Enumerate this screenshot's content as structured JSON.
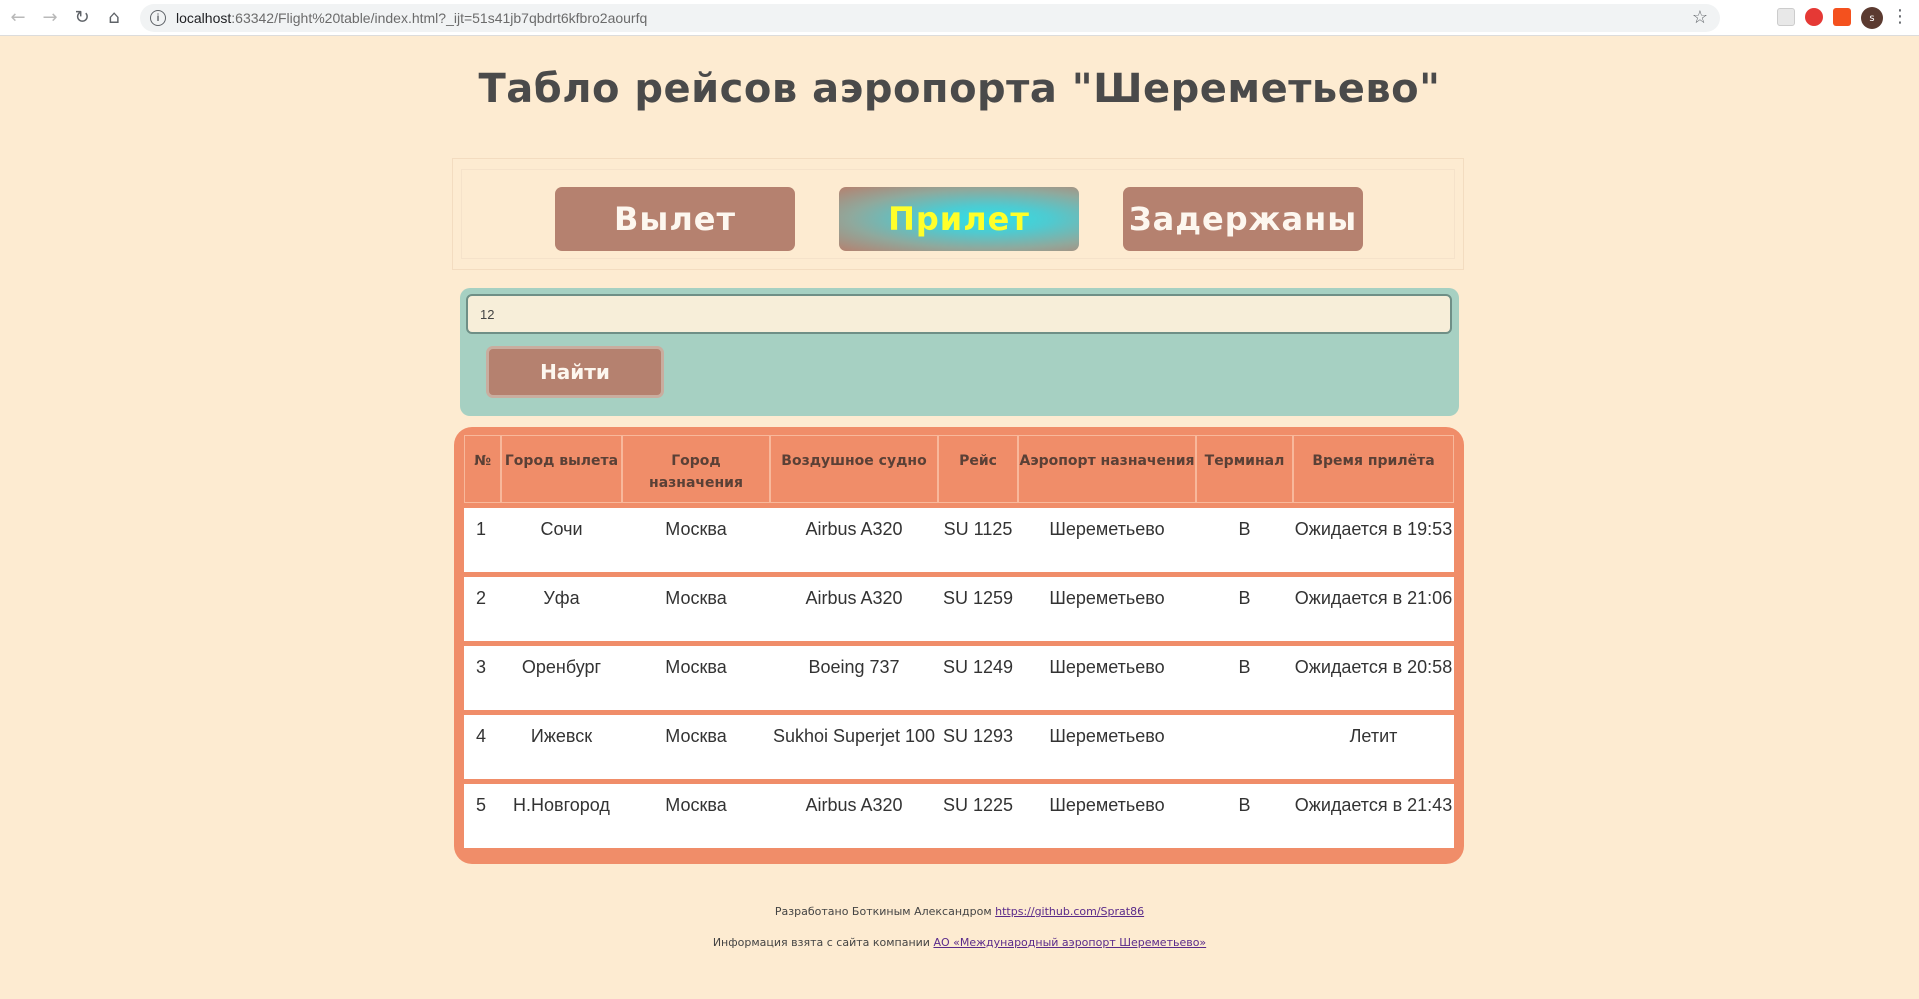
{
  "browser": {
    "url_host": "localhost",
    "url_path": ":63342/Flight%20table/index.html?_ijt=51s41jb7qbdrt6kfbro2aourfq",
    "avatar_letter": "s"
  },
  "page": {
    "title": "Табло рейсов аэропорта \"Шереметьево\""
  },
  "tabs": [
    {
      "label": "Вылет",
      "active": false
    },
    {
      "label": "Прилет",
      "active": true
    },
    {
      "label": "Задержаны",
      "active": false
    }
  ],
  "search": {
    "value": "12",
    "button_label": "Найти"
  },
  "table": {
    "headers": [
      "№",
      "Город вылета",
      "Город назначения",
      "Воздушное судно",
      "Рейс",
      "Аэропорт назначения",
      "Терминал",
      "Время прилёта"
    ],
    "rows": [
      [
        "1",
        "Сочи",
        "Москва",
        "Airbus A320",
        "SU 1125",
        "Шереметьево",
        "B",
        "Ожидается в 19:53"
      ],
      [
        "2",
        "Уфа",
        "Москва",
        "Airbus A320",
        "SU 1259",
        "Шереметьево",
        "B",
        "Ожидается в 21:06"
      ],
      [
        "3",
        "Оренбург",
        "Москва",
        "Boeing 737",
        "SU 1249",
        "Шереметьево",
        "B",
        "Ожидается в 20:58"
      ],
      [
        "4",
        "Ижевск",
        "Москва",
        "Sukhoi Superjet 100",
        "SU 1293",
        "Шереметьево",
        "",
        "Летит"
      ],
      [
        "5",
        "Н.Новгород",
        "Москва",
        "Airbus A320",
        "SU 1225",
        "Шереметьево",
        "B",
        "Ожидается в 21:43"
      ]
    ]
  },
  "footer": {
    "developer_text": "Разработано Боткиным Александром ",
    "developer_link": "https://github.com/Sprat86",
    "source_text": "Информация взята с сайта компании ",
    "source_link": " АО «Международный аэропорт Шереметьево»"
  }
}
